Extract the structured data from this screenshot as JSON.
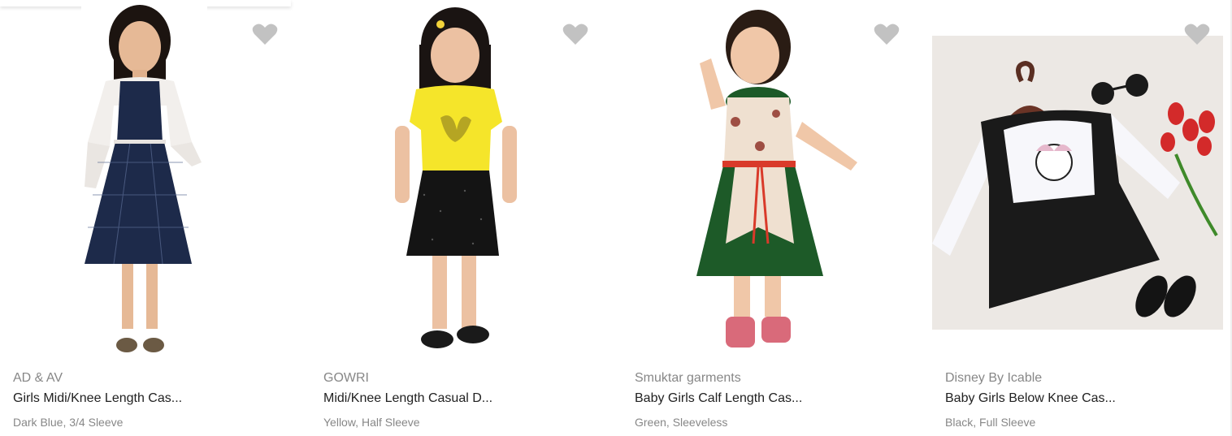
{
  "products": [
    {
      "brand": "AD & AV",
      "title": "Girls Midi/Knee Length Cas...",
      "meta": "Dark Blue, 3/4 Sleeve",
      "image": "girl-navy-check-dress"
    },
    {
      "brand": "GOWRI",
      "title": "Midi/Knee Length Casual D...",
      "meta": "Yellow, Half Sleeve",
      "image": "girl-yellow-butterfly-dress"
    },
    {
      "brand": "Smuktar garments",
      "title": "Baby Girls Calf Length Cas...",
      "meta": "Green, Sleeveless",
      "image": "girl-green-floral-dress"
    },
    {
      "brand": "Disney By Icable",
      "title": "Baby Girls Below Knee Cas...",
      "meta": "Black, Full Sleeve",
      "image": "minnie-pinafore-dress"
    }
  ],
  "colors": {
    "heart": "#c2c2c2",
    "brand_text": "#878787",
    "title_text": "#212121"
  },
  "icons": {
    "wishlist": "heart-icon"
  }
}
